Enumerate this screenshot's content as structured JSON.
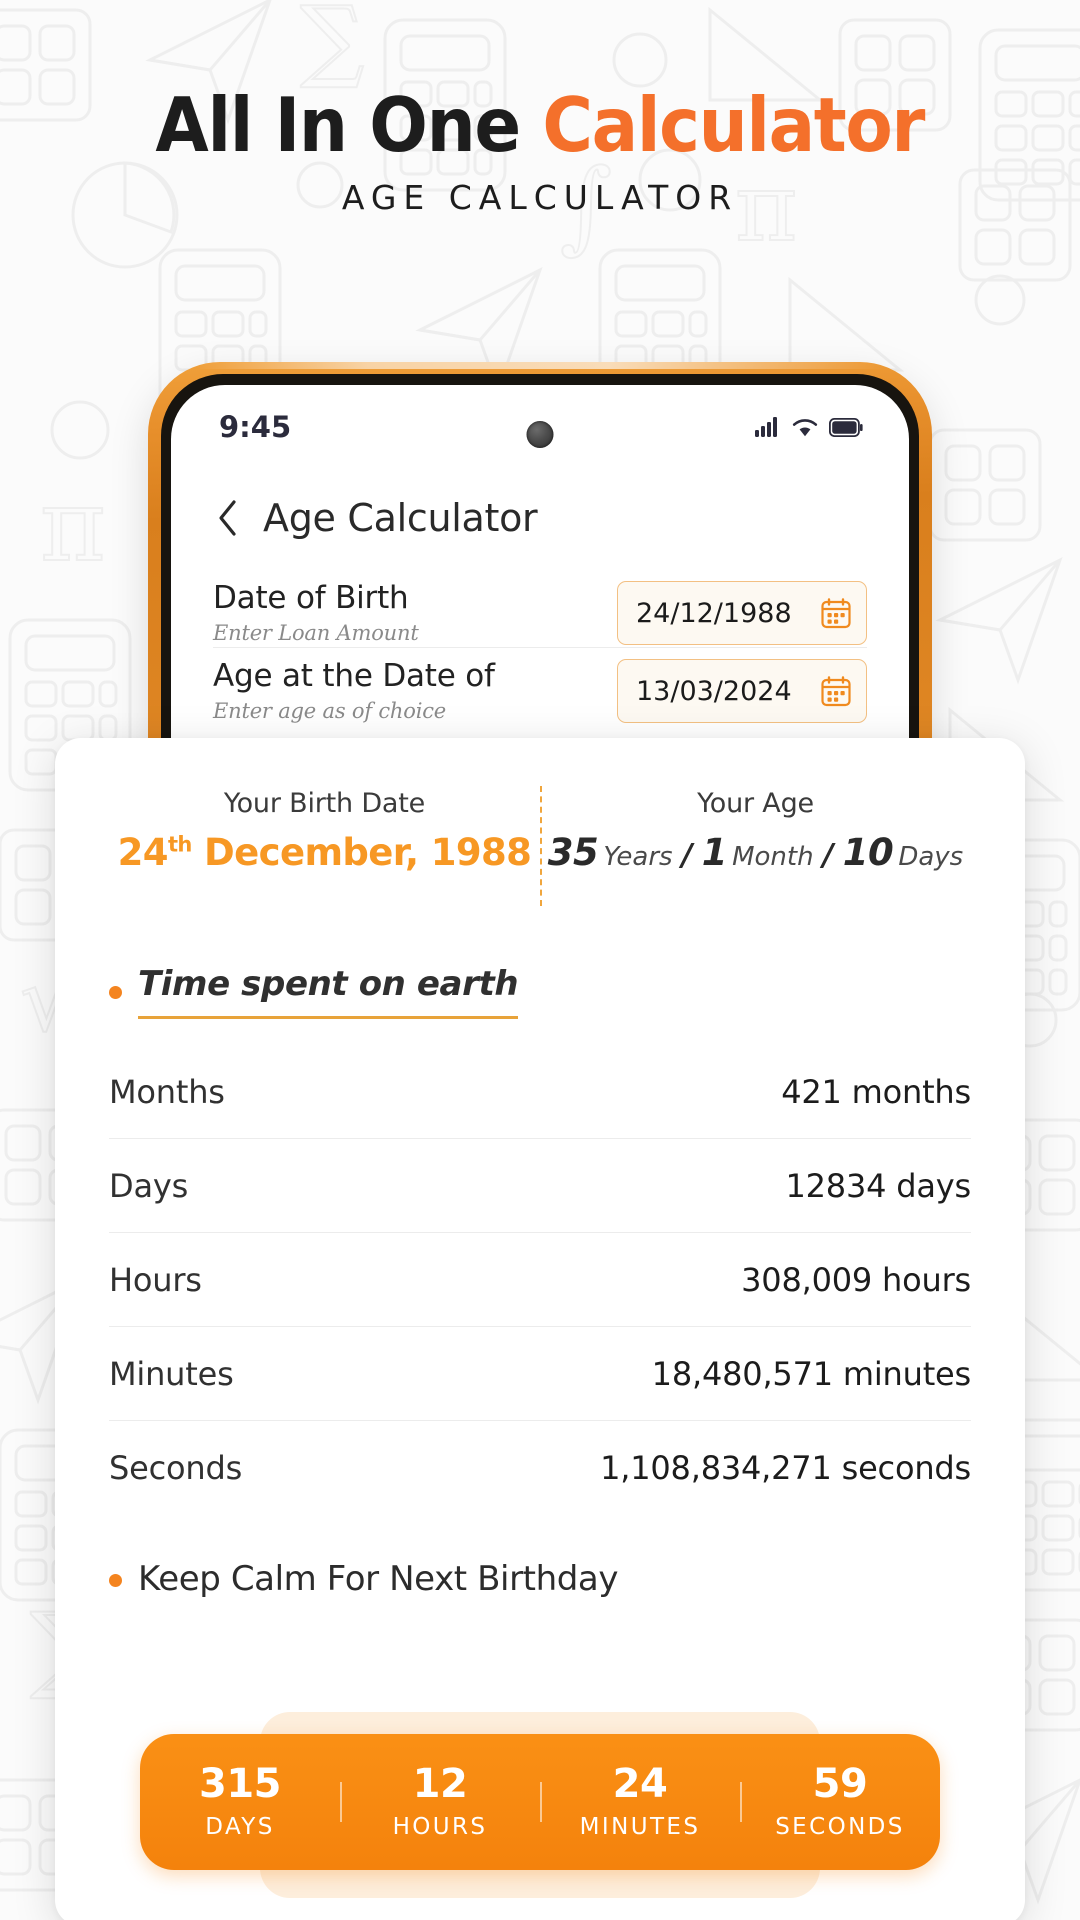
{
  "headline": {
    "part1": "All In One ",
    "part2": "Calculator",
    "subtitle": "AGE CALCULATOR"
  },
  "colors": {
    "accent_orange": "#f4702b",
    "value_orange": "#f79824",
    "bezel_orange": "#e8902c",
    "countdown_orange": "#f4820c",
    "text_dark": "#1d1d1d"
  },
  "phone": {
    "statusbar": {
      "time": "9:45",
      "icons": [
        "signal-icon",
        "wifi-icon",
        "battery-icon"
      ]
    },
    "app": {
      "back_icon": "chevron-left-icon",
      "title": "Age Calculator",
      "fields": [
        {
          "label": "Date of Birth",
          "sub": "Enter Loan Amount",
          "value": "24/12/1988",
          "icon": "calendar-icon"
        },
        {
          "label": "Age at the Date of",
          "sub": "Enter age as of choice",
          "value": "13/03/2024",
          "icon": "calendar-icon"
        }
      ]
    }
  },
  "result": {
    "birth": {
      "label": "Your Birth Date",
      "day": "24",
      "ordinal": "th",
      "rest": " December, 1988"
    },
    "age": {
      "label": "Your Age",
      "years_num": "35",
      "years_unit": "Years",
      "sep1": "/",
      "months_num": "1",
      "months_unit": "Month",
      "sep2": "/",
      "days_num": "10",
      "days_unit": "Days"
    },
    "time_section_title": "Time spent on earth",
    "stats": [
      {
        "name": "Months",
        "value": "421 months"
      },
      {
        "name": "Days",
        "value": "12834 days"
      },
      {
        "name": "Hours",
        "value": "308,009 hours"
      },
      {
        "name": "Minutes",
        "value": "18,480,571 minutes"
      },
      {
        "name": "Seconds",
        "value": "1,108,834,271 seconds"
      }
    ],
    "next_birthday_title": "Keep Calm For Next Birthday",
    "countdown": [
      {
        "num": "315",
        "unit": "DAYS"
      },
      {
        "num": "12",
        "unit": "HOURS"
      },
      {
        "num": "24",
        "unit": "MINUTES"
      },
      {
        "num": "59",
        "unit": "SECONDS"
      }
    ]
  }
}
